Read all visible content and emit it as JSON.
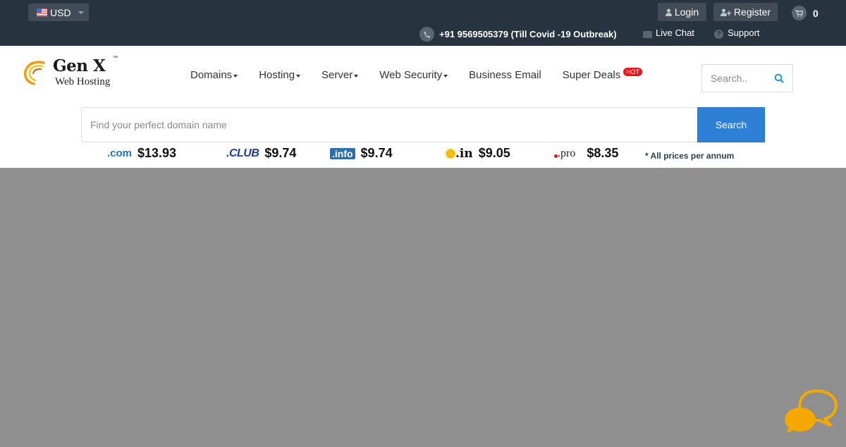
{
  "topbar": {
    "currency": {
      "label": "USD",
      "icon": "us-flag-icon"
    },
    "login_label": "Login",
    "register_label": "Register",
    "cart_count": "0",
    "phone": "+91 9569505379 (Till Covid -19 Outbreak)",
    "live_chat_label": "Live Chat",
    "support_label": "Support"
  },
  "brand": {
    "name": "Gen X",
    "trademark": "™",
    "tagline": "Web Hosting"
  },
  "nav": {
    "items": [
      {
        "label": "Domains",
        "dropdown": true
      },
      {
        "label": "Hosting",
        "dropdown": true
      },
      {
        "label": "Server",
        "dropdown": true
      },
      {
        "label": "Web Security",
        "dropdown": true
      },
      {
        "label": "Business Email",
        "dropdown": false
      },
      {
        "label": "Super Deals",
        "dropdown": false,
        "badge": "HOT"
      }
    ]
  },
  "header_search": {
    "placeholder": "Search.."
  },
  "domain_search": {
    "placeholder": "Find your perfect domain name",
    "button_label": "Search"
  },
  "tlds": [
    {
      "ext": ".com",
      "price": "$13.93"
    },
    {
      "ext": ".CLUB",
      "price": "$9.74"
    },
    {
      "ext": ".info",
      "price": "$9.74"
    },
    {
      "ext": ".in",
      "price": "$9.05"
    },
    {
      "ext": ".pro",
      "price": "$8.35"
    }
  ],
  "tld_note": "* All prices per annum",
  "colors": {
    "topbar_bg": "#27333e",
    "search_button": "#2e7fd6",
    "hot_badge": "#e8141b",
    "chat_widget": "#f5a800",
    "overlay": "#8f8f8f"
  }
}
